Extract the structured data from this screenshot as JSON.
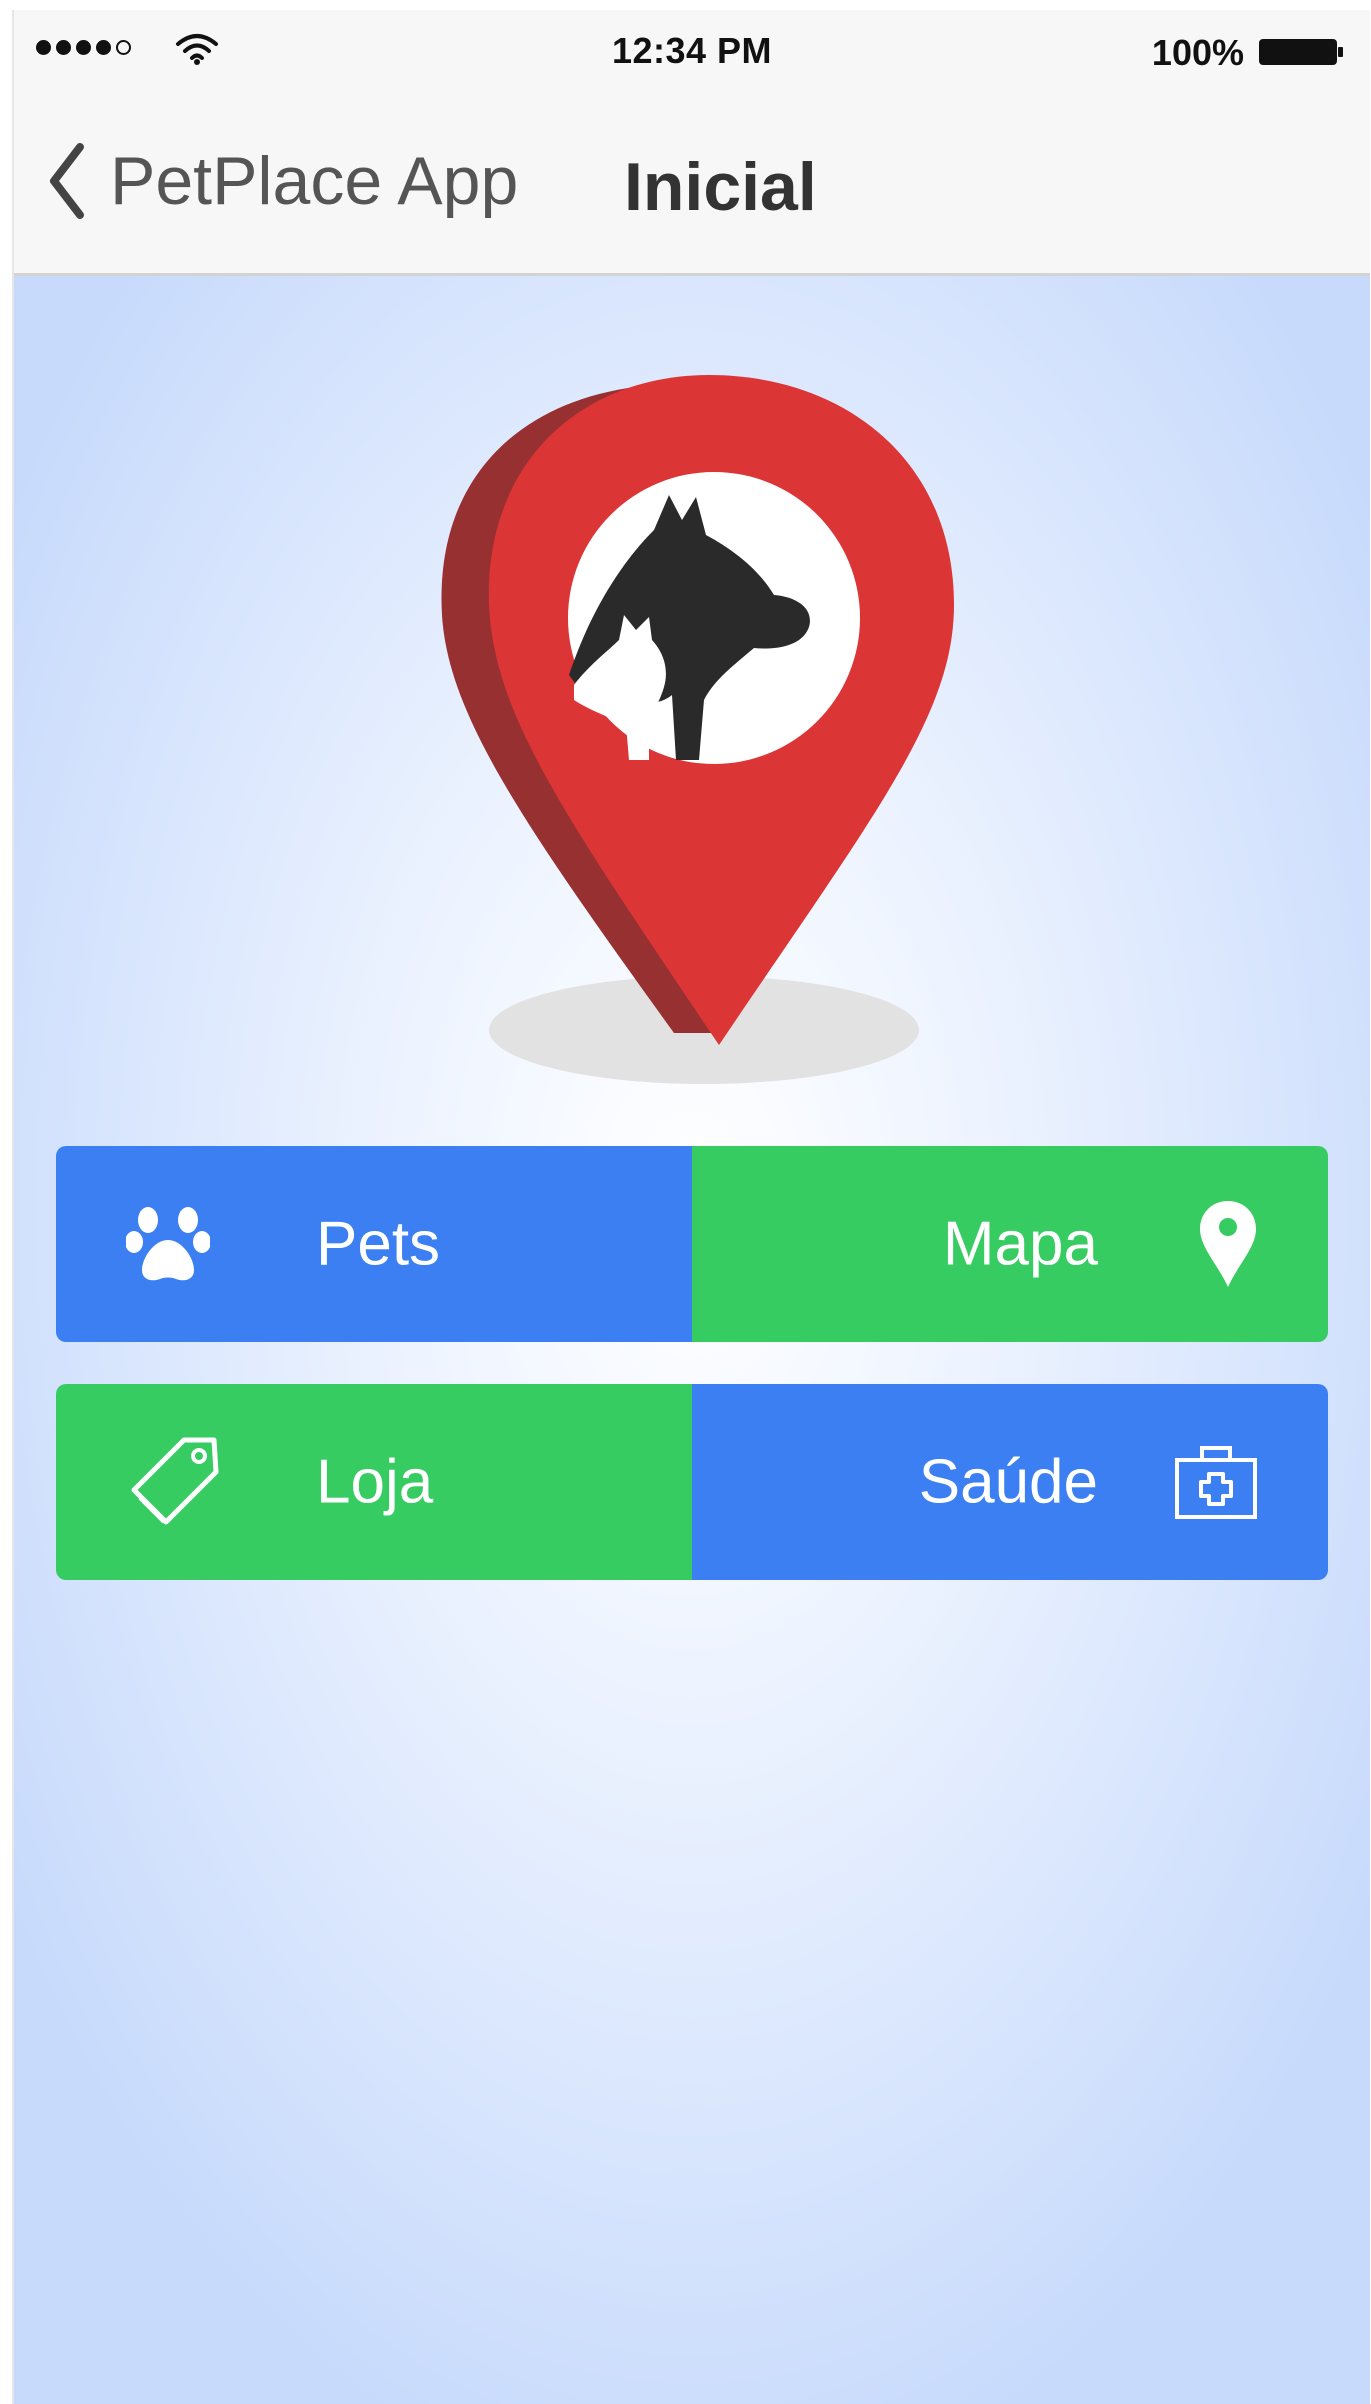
{
  "status_bar": {
    "time": "12:34 PM",
    "battery": "100%"
  },
  "nav": {
    "back_label": "PetPlace App",
    "title": "Inicial"
  },
  "logo": {
    "pin_color": "#dc3535",
    "pin_shadow_color": "#973030"
  },
  "menu": {
    "pets": "Pets",
    "mapa": "Mapa",
    "loja": "Loja",
    "saude": "Saúde"
  },
  "colors": {
    "blue": "#3b7ff3",
    "green": "#37cc62"
  },
  "icons": {
    "pets": "paw-icon",
    "mapa": "map-pin-icon",
    "loja": "tag-icon",
    "saude": "medical-kit-icon"
  }
}
